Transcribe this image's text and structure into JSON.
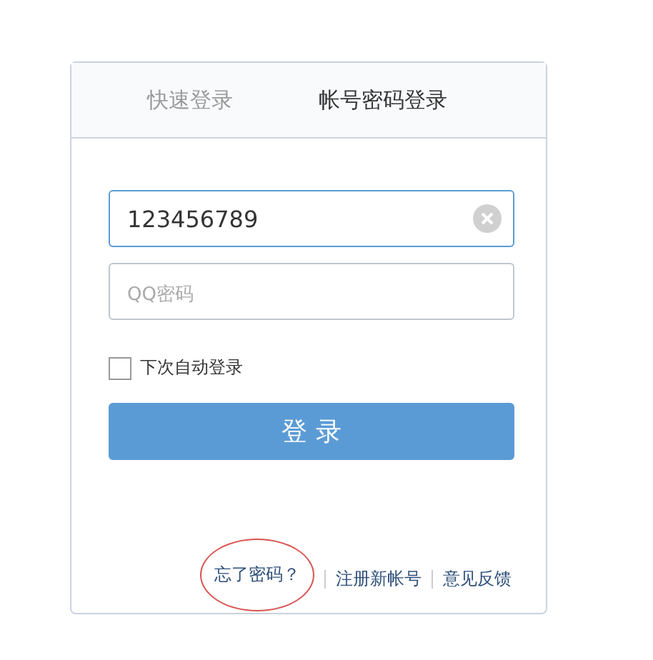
{
  "tabs": [
    {
      "label": "快速登录",
      "selected": false
    },
    {
      "label": "帐号密码登录",
      "selected": true
    }
  ],
  "account": {
    "value": "123456789",
    "clearable": true
  },
  "password": {
    "placeholder": "QQ密码"
  },
  "remember": {
    "label": "下次自动登录",
    "checked": false
  },
  "login_button": "登 录",
  "links": [
    {
      "label": "忘了密码？",
      "circled": true
    },
    {
      "label": "注册新帐号",
      "circled": false
    },
    {
      "label": "意见反馈",
      "circled": false
    }
  ]
}
